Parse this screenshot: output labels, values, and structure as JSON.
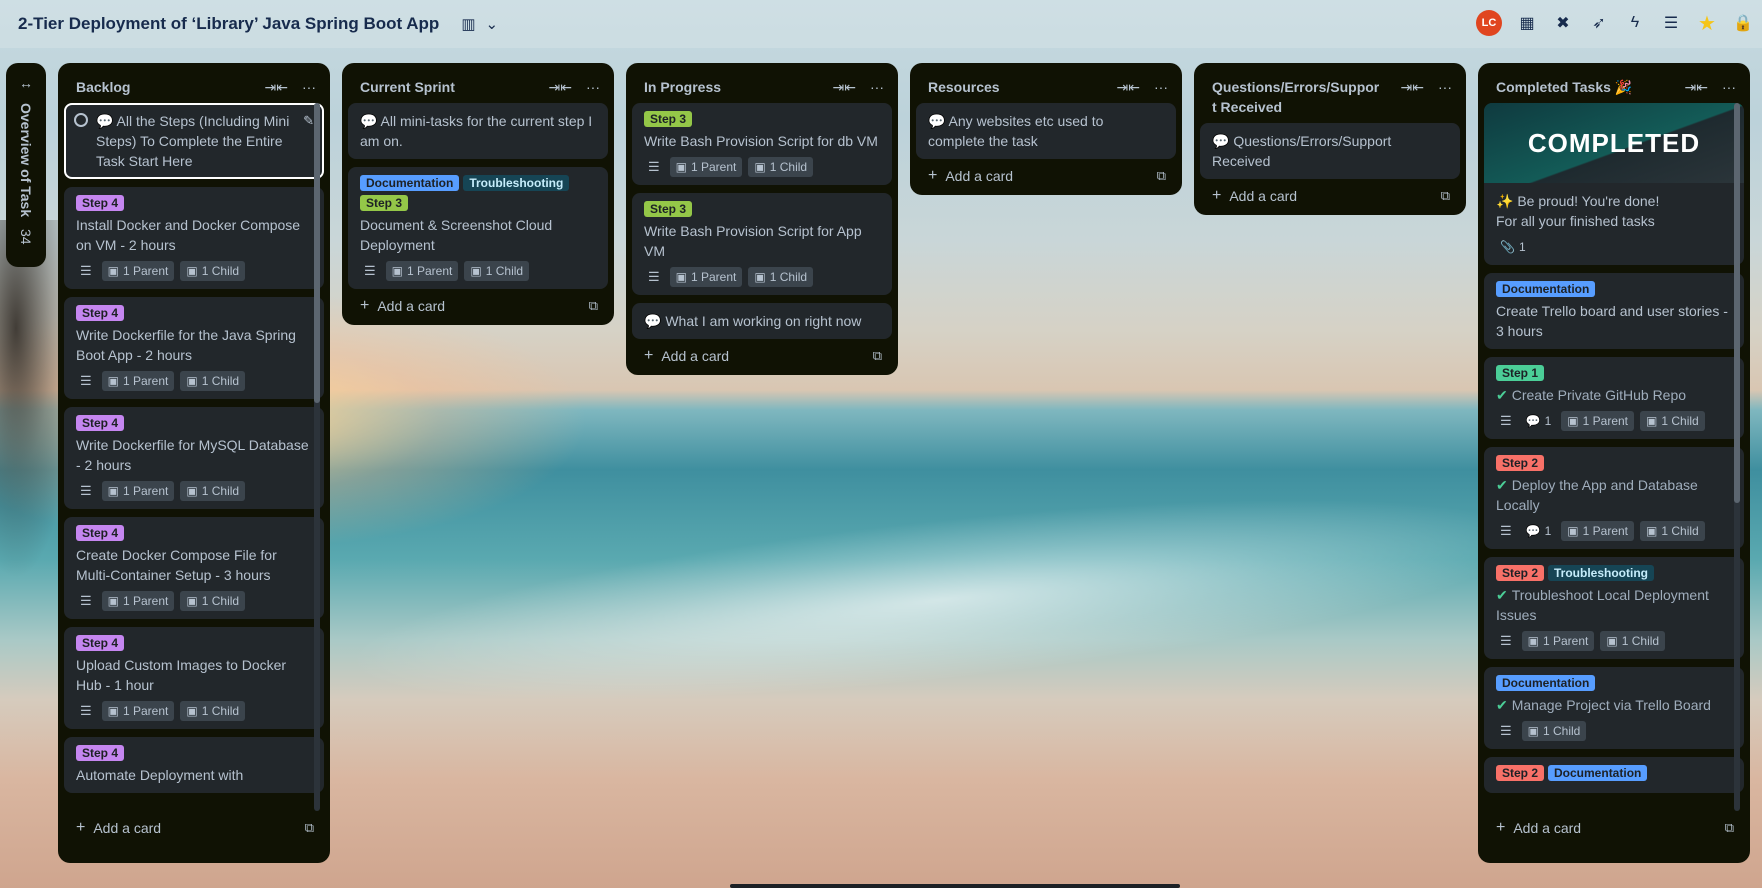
{
  "board": {
    "title": "2-Tier Deployment of ‘Library’ Java Spring Boot App",
    "view_icon": "board-view-icon",
    "view_chevron": "⌄"
  },
  "header_right": {
    "avatar_initials": "LC",
    "avatar_color": "#e0451f",
    "icons": [
      "calendar-icon",
      "map-icon",
      "rocket-icon",
      "lightning-icon",
      "filter-icon",
      "star-icon",
      "lock-icon"
    ]
  },
  "collapsed_list": {
    "title": "Overview of Task",
    "count": "34"
  },
  "lists": {
    "backlog": {
      "title": "Backlog",
      "add_label": "Add a card",
      "cards": [
        {
          "text": "💬 All the Steps (Including Mini Steps) To Complete the Entire Task Start Here"
        },
        {
          "label": "Step 4",
          "text": "Install Docker and Docker Compose on VM - 2 hours",
          "parent": "1 Parent",
          "child": "1 Child"
        },
        {
          "label": "Step 4",
          "text": "Write Dockerfile for the Java Spring Boot App - 2 hours",
          "parent": "1 Parent",
          "child": "1 Child"
        },
        {
          "label": "Step 4",
          "text": "Write Dockerfile for MySQL Database - 2 hours",
          "parent": "1 Parent",
          "child": "1 Child"
        },
        {
          "label": "Step 4",
          "text": "Create Docker Compose File for Multi-Container Setup - 3 hours",
          "parent": "1 Parent",
          "child": "1 Child"
        },
        {
          "label": "Step 4",
          "text": "Upload Custom Images to Docker Hub - 1 hour",
          "parent": "1 Parent",
          "child": "1 Child"
        },
        {
          "label": "Step 4",
          "text": "Automate Deployment with"
        }
      ]
    },
    "current_sprint": {
      "title": "Current Sprint",
      "add_label": "Add a card",
      "cards": [
        {
          "text": "💬 All mini-tasks for the current step I am on."
        },
        {
          "labels": [
            "Documentation",
            "Troubleshooting",
            "Step 3"
          ],
          "text": "Document & Screenshot Cloud Deployment",
          "parent": "1 Parent",
          "child": "1 Child"
        }
      ]
    },
    "in_progress": {
      "title": "In Progress",
      "add_label": "Add a card",
      "cards": [
        {
          "label": "Step 3",
          "text": "Write Bash Provision Script for db VM",
          "parent": "1 Parent",
          "child": "1 Child"
        },
        {
          "label": "Step 3",
          "text": "Write Bash Provision Script for App VM",
          "parent": "1 Parent",
          "child": "1 Child"
        },
        {
          "text": "💬 What I am working on right now"
        }
      ]
    },
    "resources": {
      "title": "Resources",
      "add_label": "Add a card",
      "cards": [
        {
          "text": "💬 Any websites etc used to complete the task"
        }
      ]
    },
    "questions": {
      "title": "Questions/Errors/Support Received",
      "title_line1": "Questions/Errors/Suppor",
      "title_line2": "t Received",
      "add_label": "Add a card",
      "cards": [
        {
          "text": "💬 Questions/Errors/Support Received"
        }
      ]
    },
    "completed": {
      "title": "Completed Tasks 🎉",
      "add_label": "Add a card",
      "cards": [
        {
          "cover_text": "COMPLETED",
          "text_line1": "✨ Be proud! You're done!",
          "text_line2": "For all your finished tasks",
          "attachments": "1"
        },
        {
          "label": "Documentation",
          "text": "Create Trello board and user stories - 3 hours"
        },
        {
          "label": "Step 1",
          "text": "Create Private GitHub Repo",
          "comments": "1",
          "parent": "1 Parent",
          "child": "1 Child"
        },
        {
          "label": "Step 2",
          "text": "Deploy the App and Database Locally",
          "comments": "1",
          "parent": "1 Parent",
          "child": "1 Child"
        },
        {
          "labels": [
            "Step 2",
            "Troubleshooting"
          ],
          "text": "Troubleshoot Local Deployment Issues",
          "parent": "1 Parent",
          "child": "1 Child"
        },
        {
          "label": "Documentation",
          "text": "Manage Project via Trello Board",
          "child": "1 Child"
        },
        {
          "labels": [
            "Step 2",
            "Documentation"
          ]
        }
      ]
    }
  }
}
